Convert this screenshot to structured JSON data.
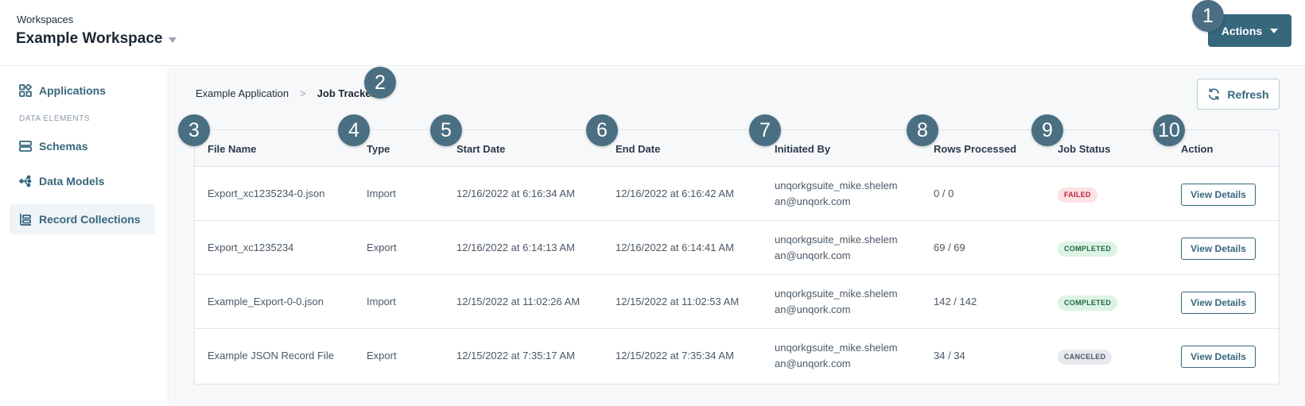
{
  "header": {
    "workspace_label": "Workspaces",
    "workspace_name": "Example Workspace",
    "actions_label": "Actions"
  },
  "sidebar": {
    "items": [
      {
        "label": "Applications",
        "icon": "apps-grid-icon"
      },
      {
        "label": "Schemas",
        "icon": "schema-icon"
      },
      {
        "label": "Data Models",
        "icon": "data-model-icon"
      },
      {
        "label": "Record Collections",
        "icon": "record-collections-icon",
        "active": true
      }
    ],
    "section_label": "DATA ELEMENTS"
  },
  "breadcrumb": {
    "parent": "Example Application",
    "separator": ">",
    "current": "Job Tracker"
  },
  "refresh_label": "Refresh",
  "table": {
    "columns": [
      "File Name",
      "Type",
      "Start Date",
      "End Date",
      "Initiated By",
      "Rows Processed",
      "Job Status",
      "Action"
    ],
    "rows": [
      {
        "file_name": "Export_xc1235234-0.json",
        "type": "Import",
        "start": "12/16/2022 at 6:16:34 AM",
        "end": "12/16/2022 at 6:16:42 AM",
        "initiated_1": "unqorkgsuite_mike.shelem",
        "initiated_2": "an@unqork.com",
        "rows": "0 / 0",
        "status": "FAILED",
        "action": "View Details"
      },
      {
        "file_name": "Export_xc1235234",
        "type": "Export",
        "start": "12/16/2022 at 6:14:13 AM",
        "end": "12/16/2022 at 6:14:41 AM",
        "initiated_1": "unqorkgsuite_mike.shelem",
        "initiated_2": "an@unqork.com",
        "rows": "69 / 69",
        "status": "COMPLETED",
        "action": "View Details"
      },
      {
        "file_name": "Example_Export-0-0.json",
        "type": "Import",
        "start": "12/15/2022 at 11:02:26 AM",
        "end": "12/15/2022 at 11:02:53 AM",
        "initiated_1": "unqorkgsuite_mike.shelem",
        "initiated_2": "an@unqork.com",
        "rows": "142 / 142",
        "status": "COMPLETED",
        "action": "View Details"
      },
      {
        "file_name": "Example JSON Record File",
        "type": "Export",
        "start": "12/15/2022 at 7:35:17 AM",
        "end": "12/15/2022 at 7:35:34 AM",
        "initiated_1": "unqorkgsuite_mike.shelem",
        "initiated_2": "an@unqork.com",
        "rows": "34 / 34",
        "status": "CANCELED",
        "action": "View Details"
      }
    ]
  },
  "callouts": [
    "1",
    "2",
    "3",
    "4",
    "5",
    "6",
    "7",
    "8",
    "9",
    "10"
  ],
  "colors": {
    "accent": "#36677d",
    "callout": "#4a6e82",
    "failed_bg": "#fde1e4",
    "completed_bg": "#ddf3e6",
    "canceled_bg": "#e6e9ed"
  }
}
